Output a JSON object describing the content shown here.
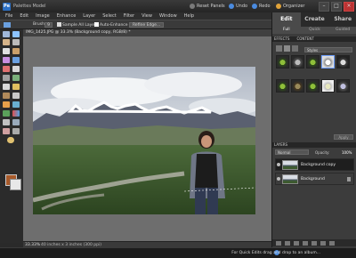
{
  "app": {
    "title": "Palettes Model",
    "icon_letter": "Pe"
  },
  "titlebar": {
    "reset_panels": "Reset Panels",
    "undo": "Undo",
    "redo": "Redo",
    "organizer": "Organizer",
    "minimize": "–",
    "maximize": "□",
    "close": "×"
  },
  "menu": [
    "File",
    "Edit",
    "Image",
    "Enhance",
    "Layer",
    "Select",
    "Filter",
    "View",
    "Window",
    "Help"
  ],
  "options": {
    "brush_label": "Brush:",
    "brush_size": "9",
    "sample_all_layers": "Sample All Layers",
    "auto_enhance": "Auto-Enhance",
    "refine_edge": "Refine Edge..."
  },
  "document": {
    "tab_label": "IMG_1425.JPG @ 33.3% (Background copy, RGB/8) *",
    "zoom": "33.33%",
    "info": "40 inches x 3 inches (300 ppi)"
  },
  "right_panel": {
    "modes": [
      "Edit",
      "Create",
      "Share"
    ],
    "sub_tabs": [
      "Full",
      "Quick",
      "Guided"
    ],
    "effects_header": [
      "EFFECTS",
      "CONTENT"
    ],
    "effects_filter": "Styles",
    "apply": "Apply",
    "layers_header": "LAYERS",
    "blend_mode": "Normal",
    "opacity_label": "Opacity:",
    "opacity_value": "100%",
    "layers": [
      {
        "name": "Background copy",
        "active": true
      },
      {
        "name": "Background",
        "active": false
      }
    ]
  },
  "project_bin": {
    "hint": "For Quick Edits drag and drop to an album..."
  },
  "colors": {
    "accent": "#2b6fc4",
    "foreground": "#a85a2a",
    "background": "#e8e8e8"
  }
}
